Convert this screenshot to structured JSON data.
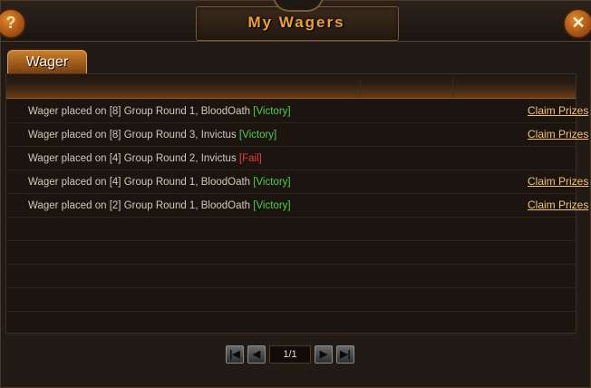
{
  "window": {
    "title": "My Wagers",
    "help_label": "?",
    "close_label": "✕"
  },
  "tabs": [
    {
      "label": "Wager",
      "active": true
    }
  ],
  "wagers": [
    {
      "text": "Wager placed on [8] Group Round 1, BloodOath ",
      "status": "[Victory]",
      "result": "victory",
      "claim": "Claim Prizes"
    },
    {
      "text": "Wager placed on [8] Group Round 3, Invictus ",
      "status": "[Victory]",
      "result": "victory",
      "claim": "Claim Prizes"
    },
    {
      "text": "Wager placed on [4] Group Round 2, Invictus ",
      "status": "[Fail]",
      "result": "fail",
      "claim": ""
    },
    {
      "text": "Wager placed on [4] Group Round 1, BloodOath ",
      "status": "[Victory]",
      "result": "victory",
      "claim": "Claim Prizes"
    },
    {
      "text": "Wager placed on [2] Group Round 1, BloodOath ",
      "status": "[Victory]",
      "result": "victory",
      "claim": "Claim Prizes"
    }
  ],
  "empty_rows": 5,
  "pagination": {
    "page": "1/1",
    "first_icon": "first-page-icon",
    "prev_icon": "prev-page-icon",
    "next_icon": "next-page-icon",
    "last_icon": "last-page-icon"
  },
  "colors": {
    "title": "#f0a030",
    "victory": "#4ed04e",
    "fail": "#e83a3a",
    "link": "#f2c47a"
  }
}
